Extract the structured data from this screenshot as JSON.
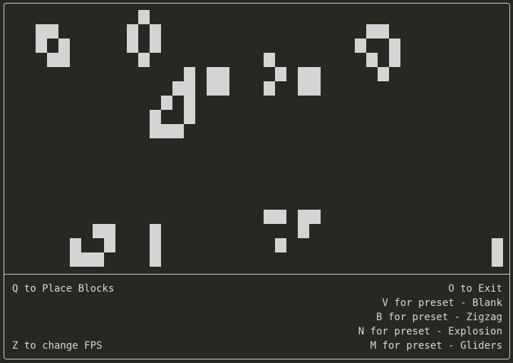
{
  "controls": {
    "place_blocks": "Q to Place Blocks",
    "change_fps": "Z to change FPS",
    "exit": "O to Exit",
    "preset_blank": "V for preset - Blank",
    "preset_zigzag": "B for preset - Zigzag",
    "preset_explosion": "N for preset - Explosion",
    "preset_gliders": "M for preset - Gliders"
  },
  "board": {
    "cell_color": "#d4d4d4",
    "background_color": "#272822",
    "border_color": "#cfcfcf",
    "live_cells": [
      [
        0,
        11
      ],
      [
        1,
        2
      ],
      [
        1,
        3
      ],
      [
        1,
        10
      ],
      [
        1,
        12
      ],
      [
        1,
        31
      ],
      [
        1,
        32
      ],
      [
        2,
        2
      ],
      [
        2,
        4
      ],
      [
        2,
        10
      ],
      [
        2,
        12
      ],
      [
        2,
        30
      ],
      [
        2,
        33
      ],
      [
        3,
        3
      ],
      [
        3,
        4
      ],
      [
        3,
        11
      ],
      [
        3,
        22
      ],
      [
        3,
        31
      ],
      [
        3,
        33
      ],
      [
        4,
        15
      ],
      [
        4,
        17
      ],
      [
        4,
        18
      ],
      [
        4,
        23
      ],
      [
        4,
        25
      ],
      [
        4,
        26
      ],
      [
        4,
        32
      ],
      [
        5,
        14
      ],
      [
        5,
        15
      ],
      [
        5,
        17
      ],
      [
        5,
        18
      ],
      [
        5,
        22
      ],
      [
        5,
        25
      ],
      [
        5,
        26
      ],
      [
        6,
        13
      ],
      [
        6,
        15
      ],
      [
        7,
        12
      ],
      [
        7,
        15
      ],
      [
        8,
        12
      ],
      [
        8,
        13
      ],
      [
        8,
        14
      ],
      [
        14,
        22
      ],
      [
        14,
        23
      ],
      [
        14,
        25
      ],
      [
        14,
        26
      ],
      [
        15,
        7
      ],
      [
        15,
        8
      ],
      [
        15,
        12
      ],
      [
        15,
        25
      ],
      [
        16,
        5
      ],
      [
        16,
        8
      ],
      [
        16,
        12
      ],
      [
        16,
        23
      ],
      [
        16,
        42
      ],
      [
        17,
        5
      ],
      [
        17,
        6
      ],
      [
        17,
        7
      ],
      [
        17,
        12
      ],
      [
        17,
        42
      ]
    ]
  }
}
